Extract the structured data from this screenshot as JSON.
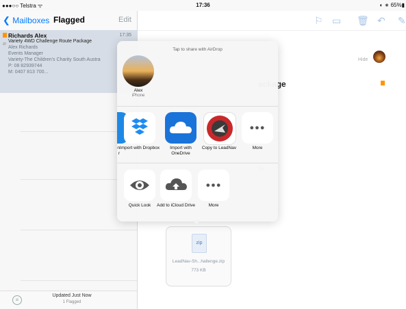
{
  "status": {
    "carrier": "●●●○○ Telstra ᯤ",
    "time": "17:36",
    "battery": "◐ ∗ 65%▮"
  },
  "nav": {
    "back_label": "Mailboxes",
    "title": "Flagged",
    "edit_label": "Edit"
  },
  "mail": {
    "sender": "Richards Alex",
    "time": "17:35",
    "subject": "Variety 4WD Challenge Route Package",
    "line1": "Alex Richards",
    "line2": "Events Manager",
    "line3": "Variety-The Children's Charity South Austra",
    "line4": "P: 08 82939744",
    "line5": "M: 0407 813 700..."
  },
  "bottom": {
    "updated": "Updated Just Now",
    "count": "1 Flagged"
  },
  "detail": {
    "hide_label": "Hide",
    "subject_fragment": "ackage",
    "body_fragment": "ia"
  },
  "attachment": {
    "type_label": "zip",
    "filename": "LeadNav-Sh...hallenge.zip",
    "size": "773 KB"
  },
  "share": {
    "airdrop_hint": "Tap to share with AirDrop",
    "contact_name": "Alex",
    "contact_device": "iPhone",
    "apps": [
      {
        "label": "Import with Dropbox"
      },
      {
        "label": "Import with OneDrive"
      },
      {
        "label": "Copy to LeadNav"
      },
      {
        "label": "More"
      }
    ],
    "partial_label_a": "n",
    "partial_label_b": "r",
    "actions": [
      {
        "label": "Quick Look"
      },
      {
        "label": "Add to iCloud Drive"
      },
      {
        "label": "More"
      }
    ]
  },
  "icons": {
    "back": "chevron-left-icon",
    "flag": "flag-icon",
    "folder": "folder-icon",
    "trash": "trash-icon",
    "reply": "reply-icon",
    "compose": "compose-icon",
    "eye": "eye-icon",
    "cloud_upload": "cloud-upload-icon",
    "dots": "more-dots-icon"
  },
  "colors": {
    "accent": "#007aff",
    "flag": "#ff9500",
    "selected_row": "#d7dde6",
    "onedrive": "#1a73d9"
  }
}
